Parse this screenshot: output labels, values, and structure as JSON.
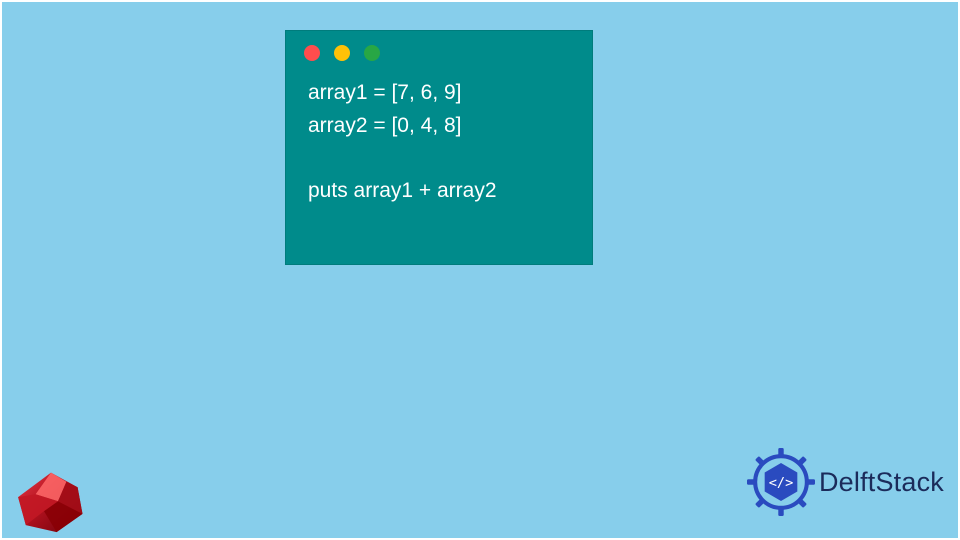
{
  "code": {
    "line1": "array1 = [7, 6, 9]",
    "line2": "array2 = [0, 4, 8]",
    "line3": "",
    "line4": "puts array1 + array2"
  },
  "brand": {
    "name": "DelftStack"
  },
  "colors": {
    "bg": "#87ceeb",
    "window": "#008b8b",
    "dot_red": "#ff4d4d",
    "dot_yellow": "#ffc107",
    "dot_green": "#28a745",
    "brand_text": "#1b2b5a",
    "brand_accent": "#2a4bbf"
  }
}
